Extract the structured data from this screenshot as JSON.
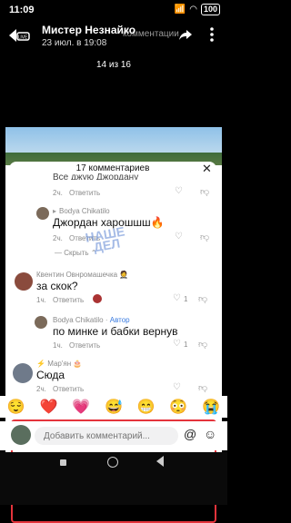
{
  "status_bar": {
    "time": "11:09",
    "battery": "100"
  },
  "header": {
    "title": "Мистер Незнайко",
    "subtitle": "23 июл. в 19:08",
    "ghost_text": "комментации",
    "counter": "14 из 16"
  },
  "comments_sheet": {
    "title": "17 комментариев",
    "prev_text": "Все джую Джордану",
    "items": [
      {
        "time": "2ч.",
        "reply": "Ответить"
      },
      {
        "author": "Bodya Chikatilo",
        "text": "Джордан харошшш🔥",
        "time": "2ч.",
        "reply": "Ответить",
        "hide": "Скрыть"
      },
      {
        "author": "Квентин Овнромашечка",
        "text": "за скок?",
        "time": "1ч.",
        "reply": "Ответить",
        "likes": "1"
      },
      {
        "author": "Bodya Chikatilo",
        "badge": "Автор",
        "text": "по минке и бабки вернув",
        "time": "1ч.",
        "reply": "Ответить",
        "likes": "1"
      },
      {
        "author": "Мар'ян",
        "text": "Сюда",
        "time": "2ч.",
        "reply": "Ответить"
      }
    ]
  },
  "watermark": {
    "line1": "НАШЕ",
    "line2": "ДЕЛ"
  },
  "emoji_bar": [
    "😌",
    "❤️",
    "💗",
    "😅",
    "😁",
    "😳",
    "😭"
  ],
  "composer": {
    "placeholder": "Добавить комментарий...",
    "at_icon": "@",
    "emoji_icon": "☺"
  }
}
